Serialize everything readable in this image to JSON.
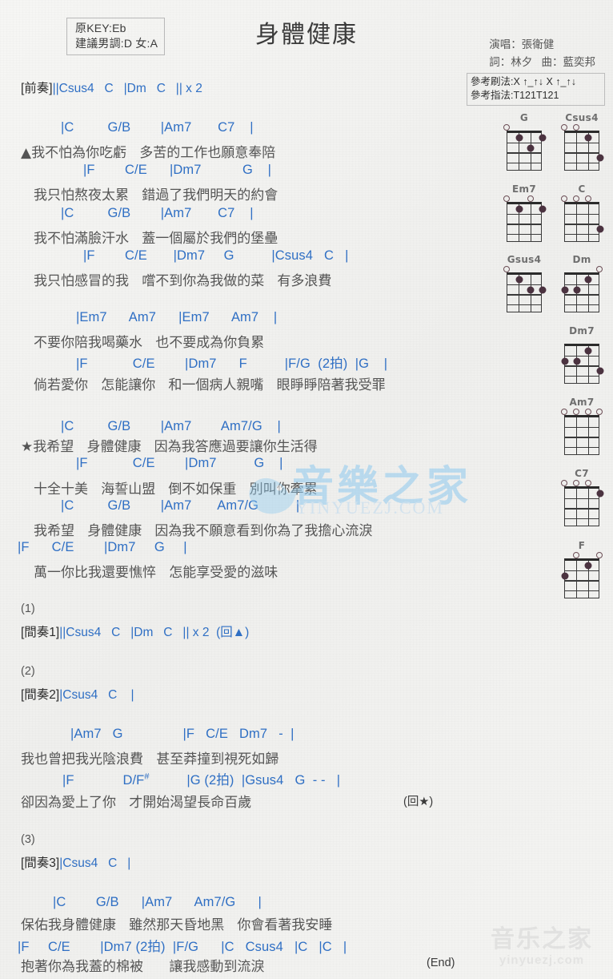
{
  "header": {
    "key_box": [
      "原KEY:Eb",
      "建議男調:D 女:A"
    ],
    "title": "身體健康",
    "singer": "演唱：張衛健",
    "writers": "詞：林夕   曲：藍奕邦",
    "strum": "參考刷法:X ↑_↑↓ X ↑_↑↓",
    "picking": "參考指法:T121T121"
  },
  "colors": {
    "chord": "#2f6fc4",
    "bar": "#8a7a2e",
    "lyric": "#555555",
    "text": "#3b3b3b",
    "watermark_blue": "#8ec9ef"
  },
  "sections": {
    "intro": {
      "label": "[前奏]",
      "chords": "||Csus4   C   |Dm   C   || x 2"
    },
    "verse1": {
      "lines": [
        {
          "chords": "|C         G/B        |Am7       C7    |",
          "lyric": "▲我不怕為你吃虧   多苦的工作也願意奉陪"
        },
        {
          "chords": "|F        C/E      |Dm7           G    |",
          "lyric": "我只怕熬夜太累   錯過了我們明天的約會"
        },
        {
          "chords": "|C         G/B        |Am7       C7    |",
          "lyric": "我不怕滿臉汗水   蓋一個屬於我們的堡壘"
        },
        {
          "chords": "|F        C/E       |Dm7     G          |Csus4   C   |",
          "lyric": "我只怕感冒的我   嚐不到你為我做的菜   有多浪費"
        }
      ]
    },
    "bridge1": {
      "lines": [
        {
          "chords": "|Em7      Am7      |Em7      Am7    |",
          "lyric": "不要你陪我喝藥水   也不要成為你負累"
        },
        {
          "chords": "|F            C/E        |Dm7      F          |F/G  (2拍)  |G    |",
          "lyric": "倘若愛你   怎能讓你   和一個病人親嘴   眼睜睜陪著我受罪"
        }
      ]
    },
    "chorus": {
      "lines": [
        {
          "chords": "|C         G/B        |Am7        Am7/G    |",
          "lyric": "★我希望   身體健康   因為我答應過要讓你生活得"
        },
        {
          "chords": "|F            C/E        |Dm7          G    |",
          "lyric": "十全十美   海誓山盟   倒不如保重   別叫你牽累"
        },
        {
          "chords": "|C         G/B        |Am7       Am7/G          |",
          "lyric": "我希望   身體健康   因為我不願意看到你為了我擔心流淚"
        },
        {
          "chords": "|F      C/E        |Dm7     G     |",
          "lyric": "萬一你比我還要憔悴   怎能享受愛的滋味"
        }
      ]
    },
    "interlude1": {
      "tag": "(1)",
      "label": "[間奏1]",
      "chords": "||Csus4   C   |Dm   C   || x 2  (回▲)"
    },
    "interlude2": {
      "tag": "(2)",
      "label": "[間奏2]",
      "chords": "|Csus4   C    |"
    },
    "verse2": {
      "lines": [
        {
          "chords": "|Am7   G                |F   C/E   Dm7   -  |",
          "lyric": "我也曾把我光陰浪費   甚至莽撞到視死如歸"
        },
        {
          "chords": "|F             D/F#          |G (2拍)  |Gsus4   G  - -   |",
          "lyric": "卻因為愛上了你   才開始渴望長命百歲",
          "tail": "(回★)"
        }
      ]
    },
    "interlude3": {
      "tag": "(3)",
      "label": "[間奏3]",
      "chords": "|Csus4   C   |"
    },
    "outro": {
      "lines": [
        {
          "chords": "|C        G/B      |Am7      Am7/G      |",
          "lyric": "保佑我身體健康   雖然那天昏地黑   你會看著我安睡"
        },
        {
          "chords": "|F     C/E        |Dm7 (2拍)  |F/G      |C   Csus4   |C   |C   |",
          "lyric": "抱著你為我蓋的棉被      讓我感動到流淚",
          "tail": "(End)"
        }
      ]
    }
  },
  "chord_diagrams": [
    {
      "name": "G",
      "opens": [
        1,
        0,
        0,
        0
      ],
      "dots": [
        [
          2,
          1
        ],
        [
          3,
          2
        ],
        [
          4,
          1
        ]
      ]
    },
    {
      "name": "Csus4",
      "opens": [
        1,
        1,
        0,
        0
      ],
      "dots": [
        [
          3,
          1
        ],
        [
          4,
          3
        ]
      ]
    },
    {
      "name": "Em7",
      "opens": [
        1,
        0,
        1,
        0
      ],
      "dots": [
        [
          2,
          1
        ],
        [
          4,
          1
        ]
      ]
    },
    {
      "name": "C",
      "opens": [
        1,
        1,
        1,
        0
      ],
      "dots": [
        [
          4,
          3
        ]
      ]
    },
    {
      "name": "Gsus4",
      "opens": [
        1,
        0,
        0,
        0
      ],
      "dots": [
        [
          2,
          1
        ],
        [
          3,
          2
        ],
        [
          4,
          2
        ]
      ]
    },
    {
      "name": "Dm",
      "opens": [
        0,
        0,
        0,
        1
      ],
      "dots": [
        [
          1,
          2
        ],
        [
          2,
          2
        ],
        [
          3,
          1
        ]
      ]
    },
    {
      "name": "Dm7",
      "opens": [
        0,
        0,
        0,
        0
      ],
      "dots": [
        [
          1,
          2
        ],
        [
          2,
          2
        ],
        [
          3,
          1
        ],
        [
          4,
          3
        ]
      ]
    },
    {
      "name": "Am7",
      "opens": [
        1,
        1,
        1,
        1
      ],
      "dots": []
    },
    {
      "name": "C7",
      "opens": [
        1,
        1,
        1,
        0
      ],
      "dots": [
        [
          4,
          1
        ]
      ]
    },
    {
      "name": "F",
      "opens": [
        0,
        1,
        0,
        1
      ],
      "dots": [
        [
          1,
          2
        ],
        [
          3,
          1
        ]
      ]
    }
  ],
  "watermark": {
    "center_big": "音樂之家",
    "center_sub": "YINYUEZJ.COM",
    "bottom_big": "音乐之家",
    "bottom_sub": "yinyuezj.com"
  }
}
